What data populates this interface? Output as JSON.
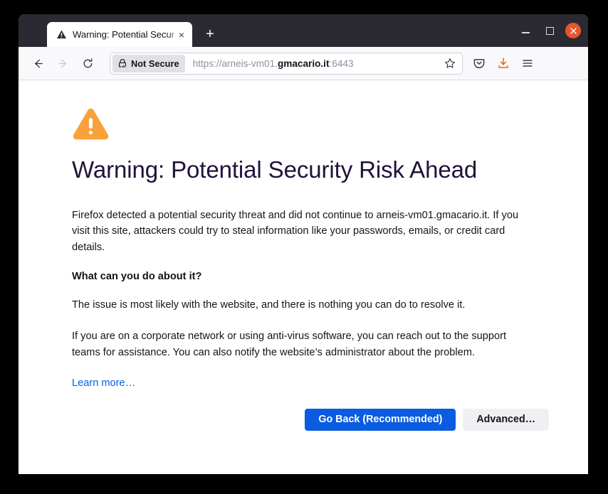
{
  "window": {
    "controls": {
      "minimize_label": "Minimize",
      "maximize_label": "Maximize",
      "close_label": "Close"
    }
  },
  "tabbar": {
    "tab": {
      "title": "Warning: Potential Security Risk Ahead",
      "favicon": "warning-triangle-icon",
      "close_label": "×"
    },
    "new_tab_label": "+"
  },
  "toolbar": {
    "back_label": "←",
    "forward_label": "→",
    "reload_label": "⟳",
    "identity": {
      "label": "Not Secure",
      "icon": "lock-warning-icon"
    },
    "url": {
      "scheme": "https://",
      "subdomain": "arneis-vm01.",
      "host": "gmacario.it",
      "port": ":6443",
      "full": "https://arneis-vm01.gmacario.it:6443"
    },
    "bookmark_icon": "star-icon",
    "pocket_icon": "pocket-icon",
    "downloads_icon": "download-icon",
    "menu_icon": "hamburger-menu-icon"
  },
  "page": {
    "icon": "warning-triangle-icon",
    "title": "Warning: Potential Security Risk Ahead",
    "paragraph1": "Firefox detected a potential security threat and did not continue to arneis-vm01.gmacario.it. If you visit this site, attackers could try to steal information like your passwords, emails, or credit card details.",
    "subheading": "What can you do about it?",
    "paragraph2": "The issue is most likely with the website, and there is nothing you can do to resolve it.",
    "paragraph3": "If you are on a corporate network or using anti-virus software, you can reach out to the support teams for assistance. You can also notify the website’s administrator about the problem.",
    "learn_more": "Learn more…",
    "buttons": {
      "primary": "Go Back (Recommended)",
      "secondary": "Advanced…"
    }
  },
  "colors": {
    "titlebar": "#2b2a33",
    "warning_orange": "#f9a13a",
    "primary_blue": "#0a5ce0",
    "link_blue": "#0060df",
    "close_red": "#e9552a",
    "download_orange": "#e66000"
  }
}
